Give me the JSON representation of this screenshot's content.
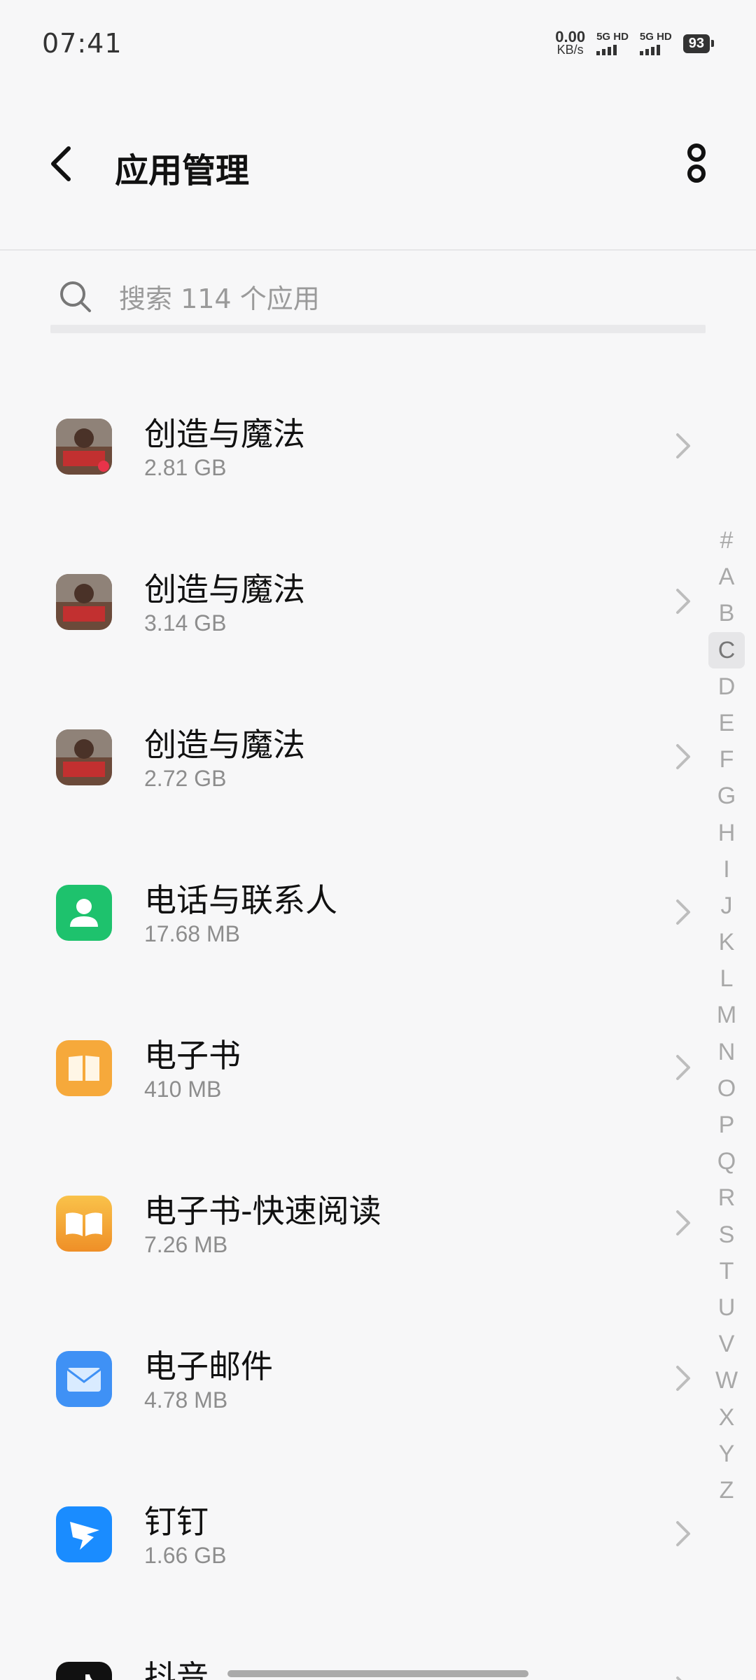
{
  "status_bar": {
    "time": "07:41",
    "net_speed_value": "0.00",
    "net_speed_unit": "KB/s",
    "sim1_label": "5G HD",
    "sim2_label": "5G HD",
    "battery": "93"
  },
  "header": {
    "title": "应用管理"
  },
  "search": {
    "placeholder": "搜索 114 个应用",
    "value": ""
  },
  "apps": [
    {
      "name": "创造与魔法",
      "size": "2.81 GB",
      "icon": "game-icon"
    },
    {
      "name": "创造与魔法",
      "size": "3.14 GB",
      "icon": "game-icon"
    },
    {
      "name": "创造与魔法",
      "size": "2.72 GB",
      "icon": "game-icon"
    },
    {
      "name": "电话与联系人",
      "size": "17.68 MB",
      "icon": "contact-icon"
    },
    {
      "name": "电子书",
      "size": "410 MB",
      "icon": "book-icon"
    },
    {
      "name": "电子书-快速阅读",
      "size": "7.26 MB",
      "icon": "book-icon"
    },
    {
      "name": "电子邮件",
      "size": "4.78 MB",
      "icon": "mail-icon"
    },
    {
      "name": "钉钉",
      "size": "1.66 GB",
      "icon": "dingtalk-icon"
    },
    {
      "name": "抖音",
      "size": "",
      "icon": "tiktok-icon"
    }
  ],
  "alpha_index": {
    "letters": [
      "#",
      "A",
      "B",
      "C",
      "D",
      "E",
      "F",
      "G",
      "H",
      "I",
      "J",
      "K",
      "L",
      "M",
      "N",
      "O",
      "P",
      "Q",
      "R",
      "S",
      "T",
      "U",
      "V",
      "W",
      "X",
      "Y",
      "Z"
    ],
    "active": "C"
  },
  "colors": {
    "contact_green": "#1ec26d",
    "book_orange": "#f6a93b",
    "mail_blue": "#3f91f5",
    "dingtalk_blue": "#1a8cff"
  }
}
